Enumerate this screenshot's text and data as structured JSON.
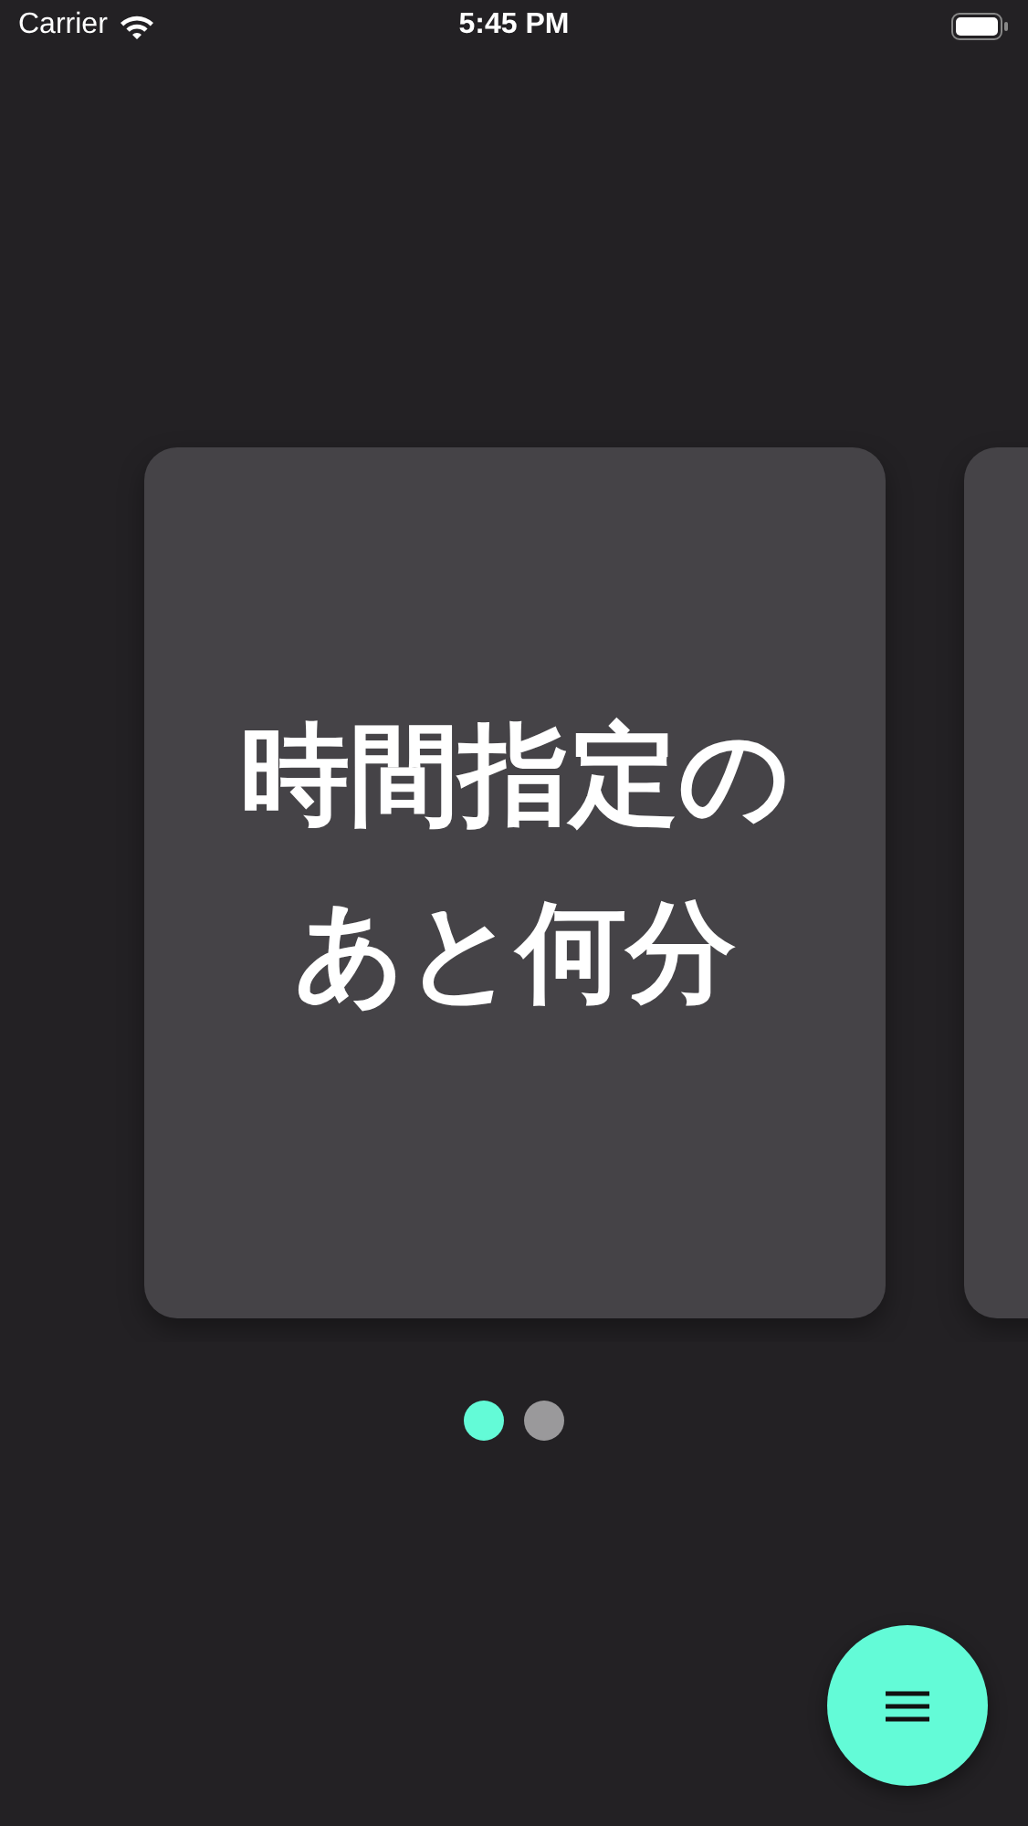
{
  "status_bar": {
    "carrier": "Carrier",
    "time": "5:45 PM"
  },
  "cards": [
    {
      "kind": "text",
      "lines": [
        "時間指定の",
        "あと何分"
      ]
    },
    {
      "kind": "blank"
    }
  ],
  "page_dots": [
    {
      "selected": true
    },
    {
      "selected": false
    }
  ],
  "fab": {
    "kind": "menu"
  }
}
